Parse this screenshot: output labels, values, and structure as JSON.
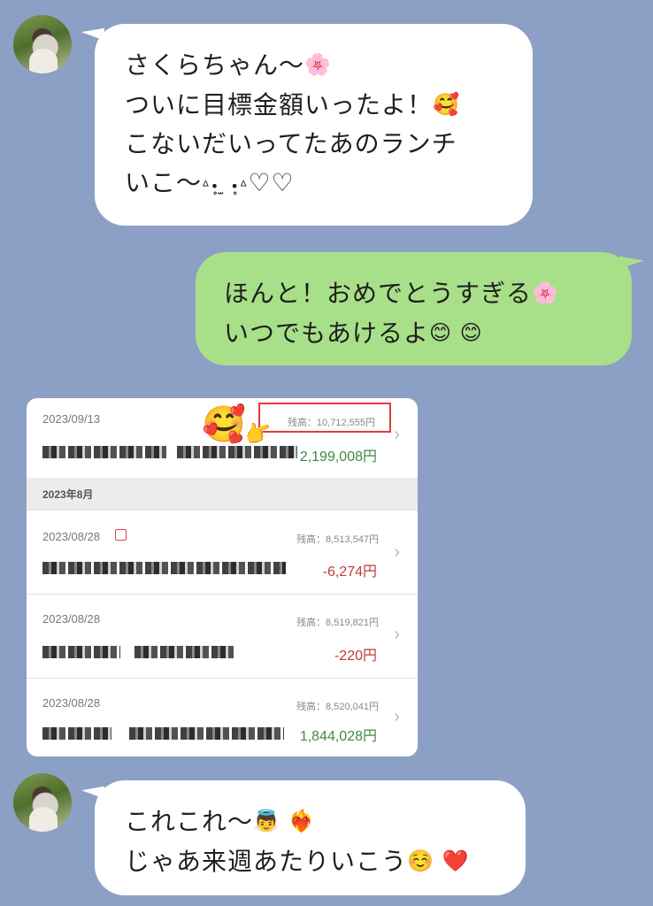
{
  "messages": [
    {
      "side": "left",
      "lines": [
        "さくらちゃん〜",
        "ついに目標金額いったよ！",
        "こないだいってたあのランチ",
        "いこ〜"
      ],
      "emojis": [
        "🌸",
        "🥰"
      ],
      "kaomoji": "ᐞ•̥ ̫ •̥ᐞ",
      "kaomoji_tail": "♡♡"
    },
    {
      "side": "right",
      "lines": [
        "ほんと！おめでとうすぎる",
        "いつでもあけるよ"
      ],
      "emojis": [
        "🌸",
        "😊 😊"
      ]
    },
    {
      "side": "left",
      "lines": [
        "これこれ〜",
        "じゃあ来週あたりいこう"
      ],
      "emojis": [
        "👼 ❤️‍🔥",
        "☺️ ❤️"
      ]
    }
  ],
  "bank": {
    "overlay_emoji": "🥰",
    "pointer_emoji": "👉",
    "month_label": "2023年8月",
    "transactions": [
      {
        "date": "2023/09/13",
        "balance": "残高：10,712,555円",
        "amount": "2,199,008円",
        "sign": "pos"
      },
      {
        "date": "2023/08/28",
        "balance": "残高：8,513,547円",
        "amount": "-6,274円",
        "sign": "neg"
      },
      {
        "date": "2023/08/28",
        "balance": "残高：8,519,821円",
        "amount": "-220円",
        "sign": "neg"
      },
      {
        "date": "2023/08/28",
        "balance": "残高：8,520,041円",
        "amount": "1,844,028円",
        "sign": "pos"
      }
    ],
    "chevron": "›"
  },
  "colors": {
    "background": "#8c9fc5",
    "bubble_white": "#ffffff",
    "bubble_green": "#a8e089",
    "positive": "#3f8a44",
    "negative": "#c23b3b",
    "highlight": "#e23a3a"
  },
  "icons": [
    "avatar",
    "chevron-right-icon",
    "shop-icon"
  ]
}
